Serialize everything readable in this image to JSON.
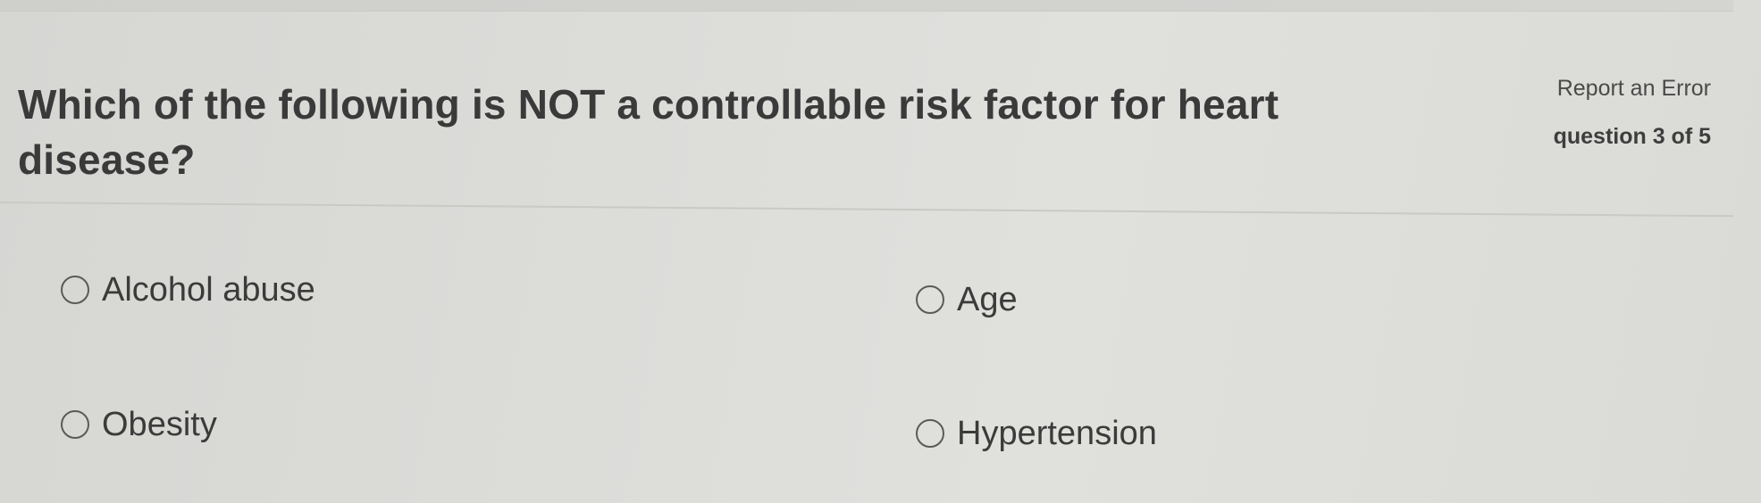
{
  "question": {
    "text": "Which of the following is NOT a controllable risk factor for heart disease?"
  },
  "meta": {
    "report_label": "Report an Error",
    "progress_label": "question 3 of 5"
  },
  "options": [
    {
      "label": "Alcohol abuse",
      "selected": false
    },
    {
      "label": "Age",
      "selected": false
    },
    {
      "label": "Obesity",
      "selected": false
    },
    {
      "label": "Hypertension",
      "selected": false
    }
  ],
  "colors": {
    "background": "#dcdcd9",
    "text": "#3a3a3a",
    "divider": "#c9c9c6"
  }
}
